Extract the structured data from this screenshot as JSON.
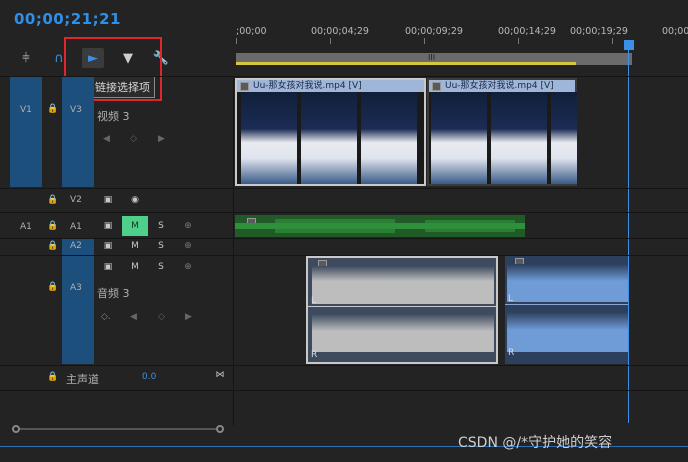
{
  "timecode": "00;00;21;21",
  "ruler": {
    "ticks": [
      ";00;00",
      "00;00;04;29",
      "00;00;09;29",
      "00;00;14;29",
      "00;00;19;29",
      "00;00"
    ],
    "work_area_label": "III"
  },
  "toolbar": {
    "tooltip": "链接选择项"
  },
  "tracks": {
    "v3": {
      "src": "V1",
      "name": "V3",
      "label": "视频 3"
    },
    "v2": {
      "name": "V2"
    },
    "a1": {
      "src": "A1",
      "name": "A1",
      "mute": "M",
      "solo": "S"
    },
    "a2": {
      "name": "A2",
      "mute": "M",
      "solo": "S"
    },
    "a3": {
      "name": "A3",
      "mute": "M",
      "solo": "S",
      "label": "音频 3"
    },
    "master": {
      "label": "主声道",
      "value": "0.0"
    }
  },
  "clips": [
    {
      "title": "Uu-那女孩对我说.mp4 [V]"
    },
    {
      "title": "Uu-那女孩对我说.mp4 [V]"
    }
  ],
  "audio_channel_labels": {
    "left": "L",
    "right": "R"
  },
  "watermark": "CSDN @/*守护她的笑容",
  "colors": {
    "accent": "#2e8fe8",
    "track_header": "#1c4f7c",
    "mute_active": "#4fd08a",
    "audio_clip_a": "#bdbdbd",
    "audio_clip_b": "#6f9bd6",
    "tooltip_border": "#e0262a"
  }
}
